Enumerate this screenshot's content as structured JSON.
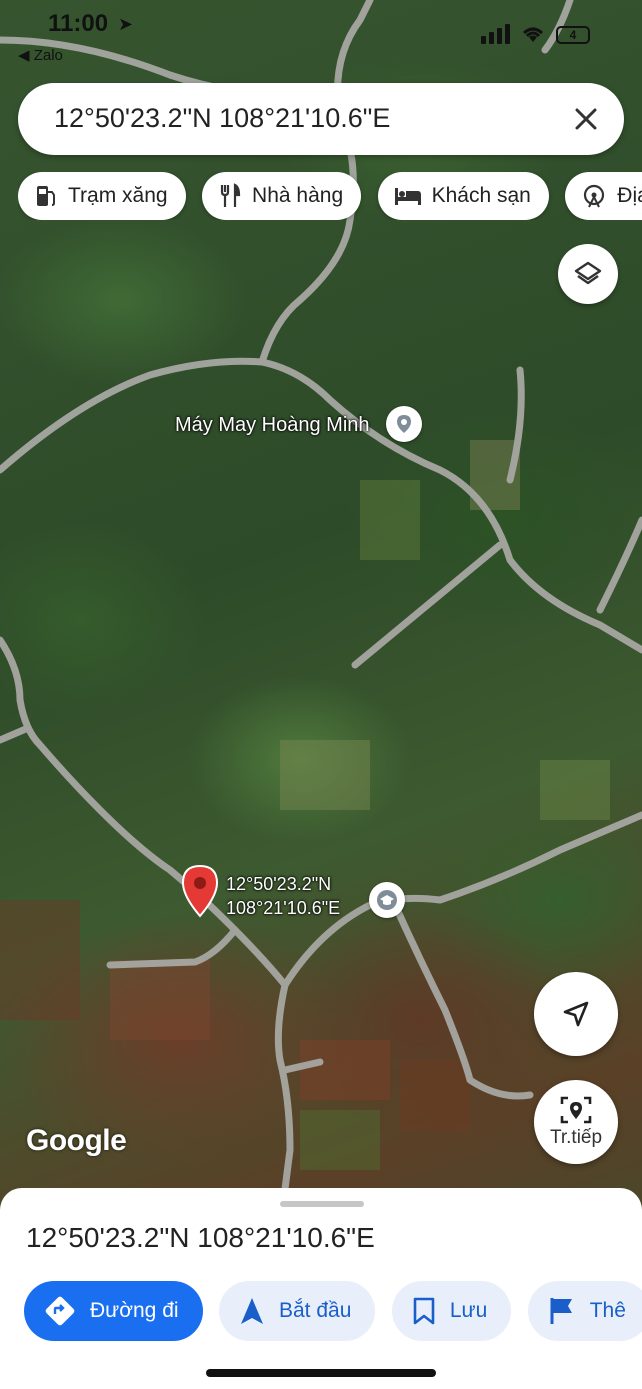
{
  "status_bar": {
    "time": "11:00",
    "back_app": "◀ Zalo",
    "battery": "4"
  },
  "search": {
    "query": "12°50'23.2\"N 108°21'10.6\"E"
  },
  "chips": [
    {
      "label": "Trạm xăng",
      "icon": "gas-station-icon"
    },
    {
      "label": "Nhà hàng",
      "icon": "restaurant-icon"
    },
    {
      "label": "Khách sạn",
      "icon": "hotel-icon"
    },
    {
      "label": "Địa đ",
      "icon": "attraction-icon"
    }
  ],
  "map": {
    "place_name": "Máy May Hoàng Minh",
    "pin_coord_line1": "12°50'23.2\"N",
    "pin_coord_line2": "108°21'10.6\"E",
    "logo": "Google",
    "pin_color": "#e53935"
  },
  "controls": {
    "live_view_label": "Tr.tiếp"
  },
  "sheet": {
    "title": "12°50'23.2\"N 108°21'10.6\"E",
    "actions": [
      {
        "label": "Đường đi",
        "icon": "directions-icon"
      },
      {
        "label": "Bắt đầu",
        "icon": "navigation-arrow-icon"
      },
      {
        "label": "Lưu",
        "icon": "bookmark-icon"
      },
      {
        "label": "Thê",
        "icon": "flag-icon"
      }
    ]
  },
  "colors": {
    "accent": "#1a6ff0",
    "action_bg": "#e8effa",
    "action_text": "#1a5fc9"
  }
}
